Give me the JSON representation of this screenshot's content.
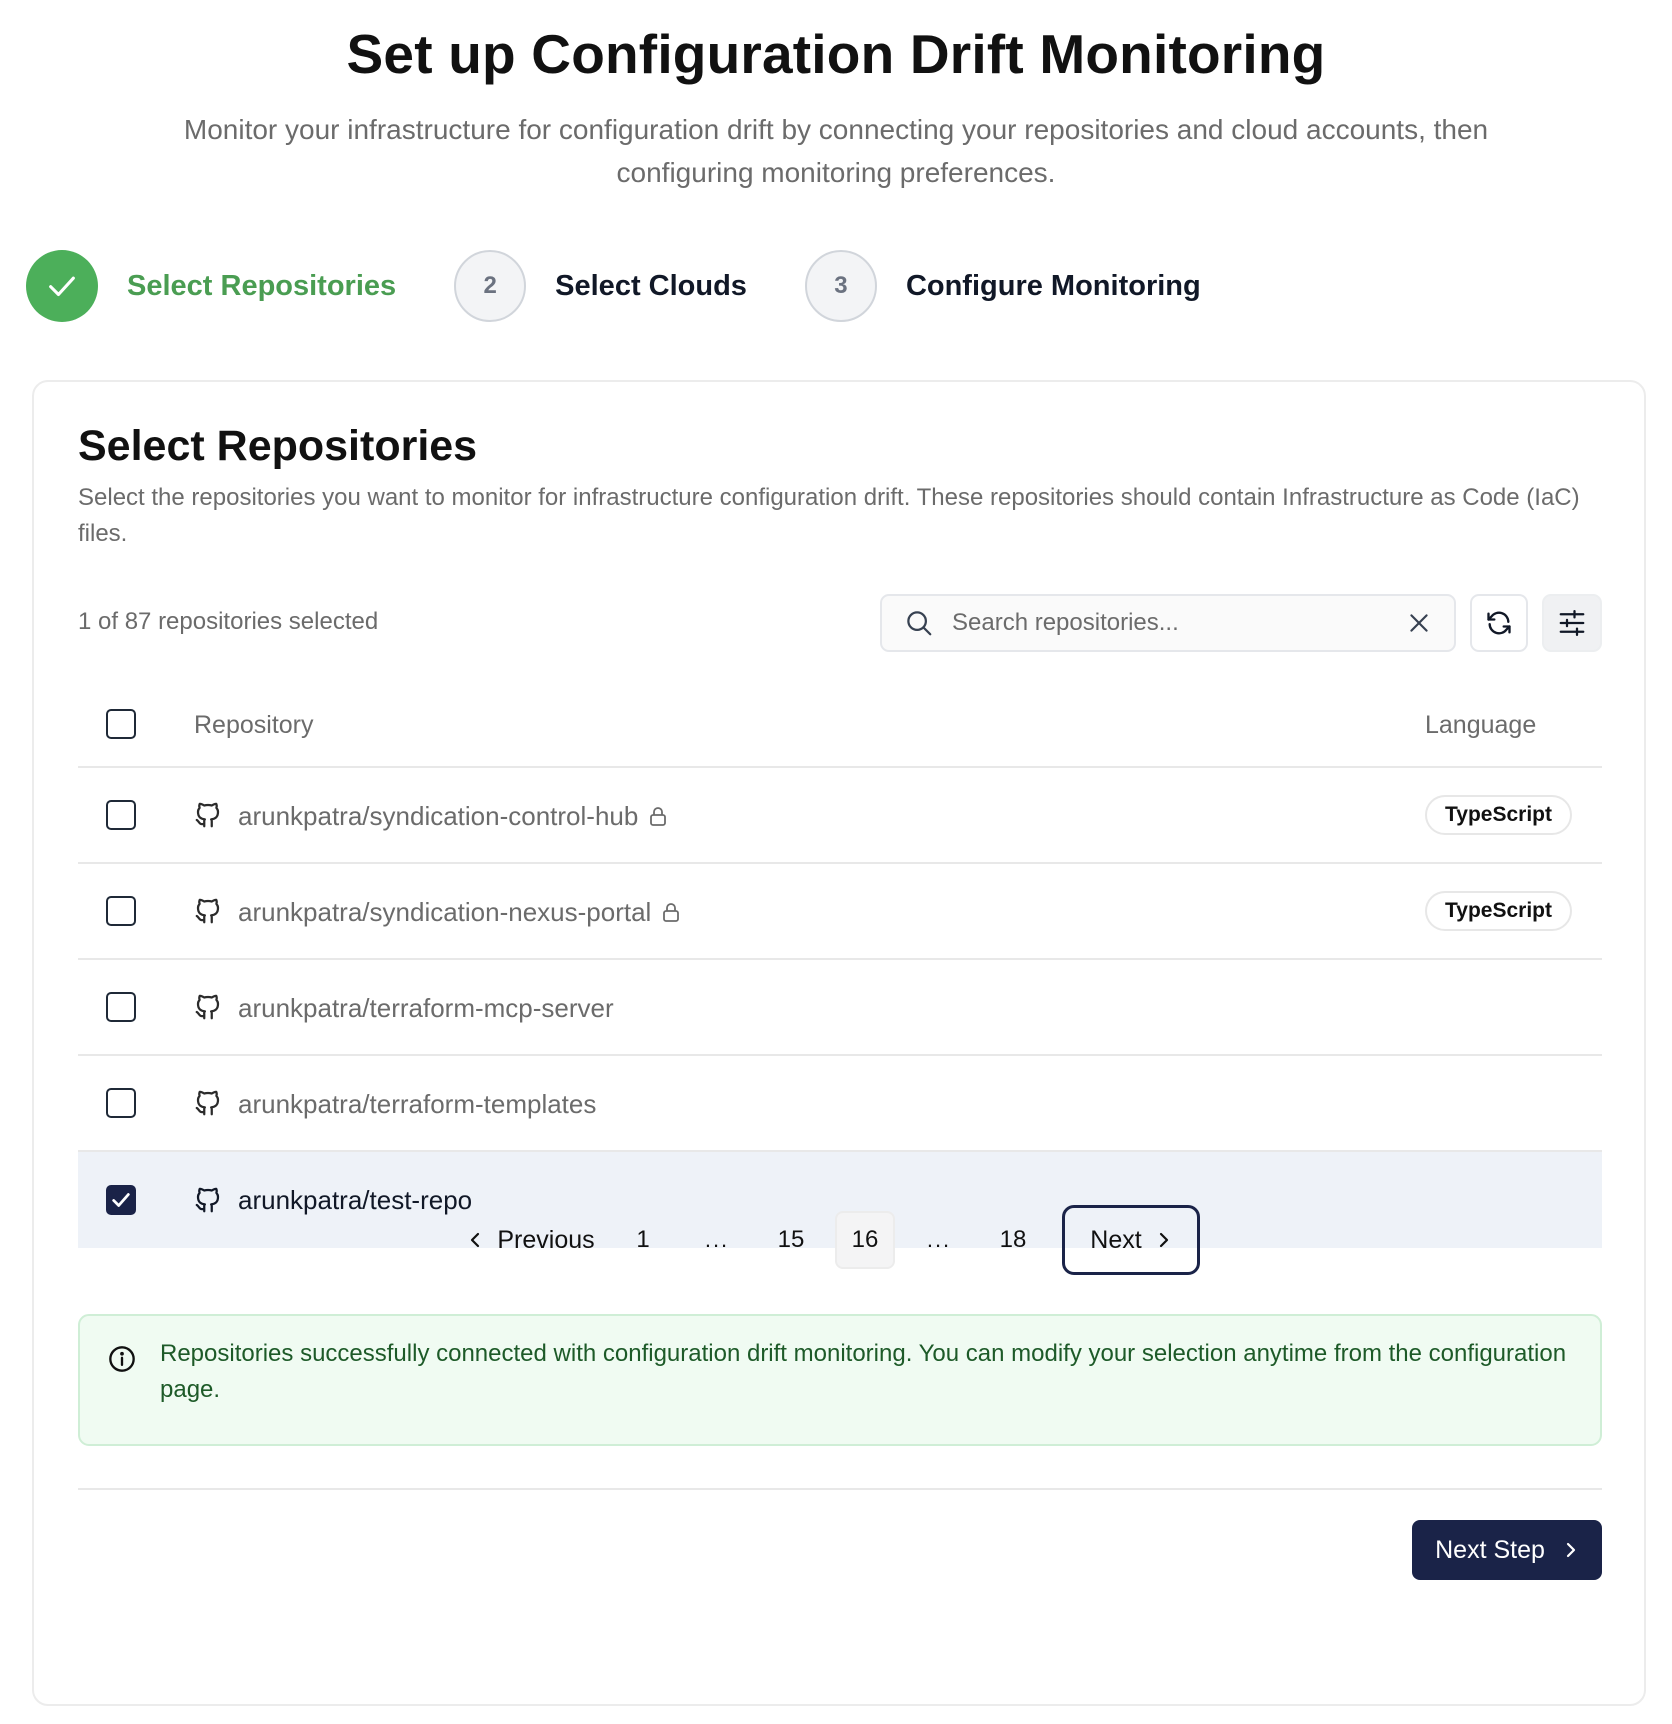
{
  "header": {
    "title": "Set up Configuration Drift Monitoring",
    "subtitle": "Monitor your infrastructure for configuration drift by connecting your repositories and cloud accounts, then configuring monitoring preferences."
  },
  "stepper": {
    "steps": [
      {
        "number": "",
        "label": "Select Repositories",
        "state": "completed"
      },
      {
        "number": "2",
        "label": "Select Clouds",
        "state": "pending"
      },
      {
        "number": "3",
        "label": "Configure Monitoring",
        "state": "pending"
      }
    ]
  },
  "card": {
    "title": "Select Repositories",
    "description": "Select the repositories you want to monitor for infrastructure configuration drift. These repositories should contain Infrastructure as Code (IaC) files.",
    "selection_count": "1 of 87 repositories selected",
    "search": {
      "placeholder": "Search repositories...",
      "value": ""
    },
    "table": {
      "columns": {
        "repository": "Repository",
        "language": "Language"
      },
      "rows": [
        {
          "name": "arunkpatra/syndication-control-hub",
          "private": true,
          "language": "TypeScript",
          "checked": false
        },
        {
          "name": "arunkpatra/syndication-nexus-portal",
          "private": true,
          "language": "TypeScript",
          "checked": false
        },
        {
          "name": "arunkpatra/terraform-mcp-server",
          "private": false,
          "language": "",
          "checked": false
        },
        {
          "name": "arunkpatra/terraform-templates",
          "private": false,
          "language": "",
          "checked": false
        },
        {
          "name": "arunkpatra/test-repo",
          "private": false,
          "language": "",
          "checked": true
        }
      ]
    },
    "pagination": {
      "previous": "Previous",
      "first": "1",
      "ellipsis": "...",
      "before": "15",
      "current": "16",
      "last": "18",
      "next": "Next"
    },
    "banner": {
      "text": "Repositories successfully connected with configuration drift monitoring. You can modify your selection anytime from the configuration page."
    },
    "next_step_label": "Next Step"
  },
  "colors": {
    "success": "#4caf5a",
    "primary": "#1a2348",
    "banner_bg": "#f0fbf2",
    "selected_row": "#eef2f8"
  }
}
